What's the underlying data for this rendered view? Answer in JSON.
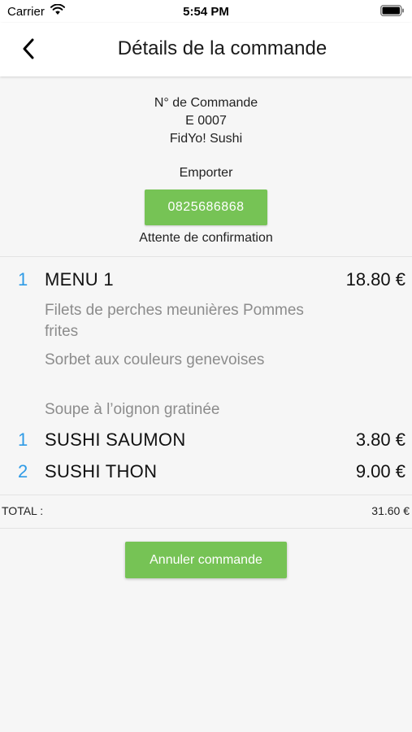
{
  "status_bar": {
    "carrier": "Carrier",
    "time": "5:54 PM"
  },
  "nav": {
    "title": "Détails de la commande",
    "back_icon": "chevron-left-icon"
  },
  "order": {
    "number_label": "N° de Commande",
    "number": "E 0007",
    "restaurant": "FidYo! Sushi",
    "mode": "Emporter",
    "phone": "0825686868",
    "status": "Attente de confirmation"
  },
  "items": [
    {
      "qty": "1",
      "name": "MENU 1",
      "price": "18.80 €",
      "details": [
        "Filets de perches meunières Pommes frites",
        "Sorbet aux couleurs genevoises",
        "Soupe à l’oignon gratinée"
      ]
    },
    {
      "qty": "1",
      "name": "SUSHI SAUMON",
      "price": "3.80 €"
    },
    {
      "qty": "2",
      "name": "SUSHI THON",
      "price": "9.00 €"
    }
  ],
  "total": {
    "label": "TOTAL :",
    "value": "31.60 €"
  },
  "actions": {
    "cancel_label": "Annuler commande"
  },
  "colors": {
    "accent_green": "#76c355",
    "quantity_blue": "#2f9be6",
    "detail_gray": "#8c8c8c"
  }
}
